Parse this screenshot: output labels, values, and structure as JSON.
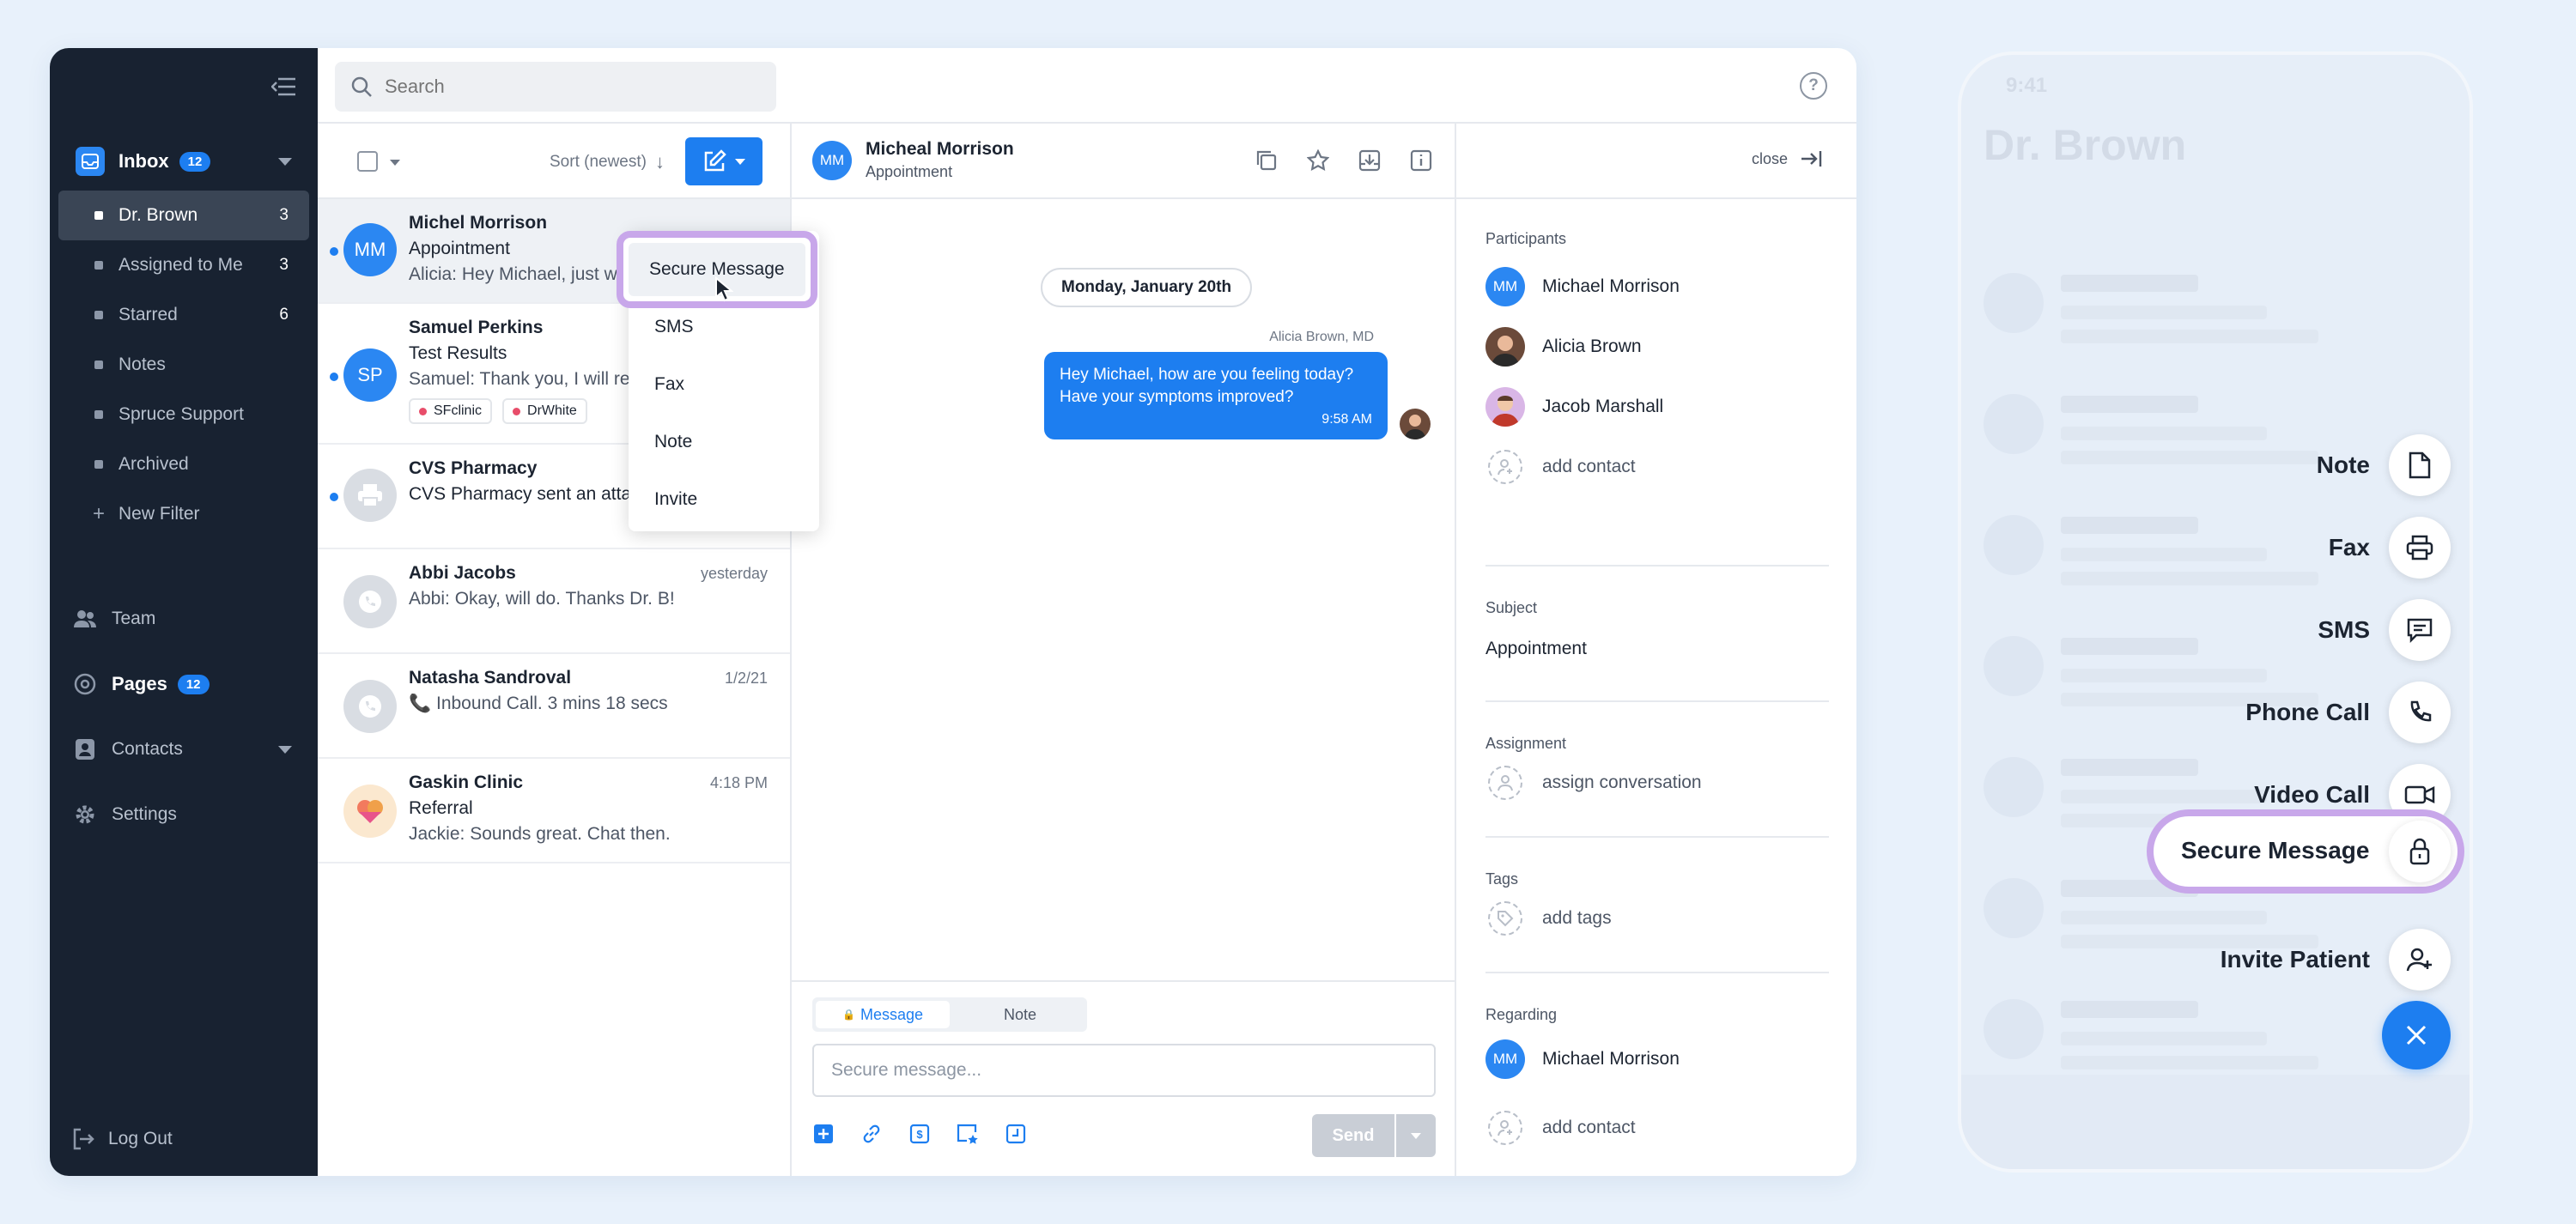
{
  "sidebar": {
    "inbox_label": "Inbox",
    "inbox_count": "12",
    "sub_items": [
      {
        "label": "Dr. Brown",
        "count": "3"
      },
      {
        "label": "Assigned to Me",
        "count": "3"
      },
      {
        "label": "Starred",
        "count": "6"
      },
      {
        "label": "Notes",
        "count": ""
      },
      {
        "label": "Spruce Support",
        "count": ""
      },
      {
        "label": "Archived",
        "count": ""
      },
      {
        "label": "New Filter",
        "count": ""
      }
    ],
    "team_label": "Team",
    "pages_label": "Pages",
    "pages_count": "12",
    "contacts_label": "Contacts",
    "settings_label": "Settings",
    "logout_label": "Log Out"
  },
  "search": {
    "placeholder": "Search"
  },
  "list_toolbar": {
    "sort_label": "Sort (newest)"
  },
  "conversations": [
    {
      "name": "Michel Morrison",
      "initials": "MM",
      "subject": "Appointment",
      "preview": "Alicia: Hey Michael, just wanted to check",
      "time": ""
    },
    {
      "name": "Samuel Perkins",
      "initials": "SP",
      "subject": "Test Results",
      "preview": "Samuel: Thank you, I will review.",
      "time": "",
      "tags": [
        "SFclinic",
        "DrWhite"
      ]
    },
    {
      "name": "CVS Pharmacy",
      "initials": "",
      "subject": "",
      "preview": "CVS Pharmacy sent an attachment",
      "time": ""
    },
    {
      "name": "Abbi Jacobs",
      "initials": "",
      "subject": "",
      "preview": "Abbi: Okay, will do. Thanks Dr. B!",
      "time": "yesterday"
    },
    {
      "name": "Natasha Sandroval",
      "initials": "",
      "subject": "",
      "preview": "Inbound Call. 3 mins 18 secs",
      "time": "1/2/21"
    },
    {
      "name": "Gaskin Clinic",
      "initials": "",
      "subject": "Referral",
      "preview": "Jackie: Sounds great. Chat then.",
      "time": "4:18 PM"
    }
  ],
  "compose_menu": [
    "Secure Message",
    "SMS",
    "Fax",
    "Note",
    "Invite"
  ],
  "chat": {
    "contact_name": "Micheal Morrison",
    "contact_initials": "MM",
    "subject": "Appointment",
    "date_chip": "Monday, January 20th",
    "sender": "Alicia Brown, MD",
    "message_line1": "Hey Michael, how are you feeling today?",
    "message_line2": "Have your symptoms improved?",
    "message_time": "9:58 AM",
    "tab_message": "Message",
    "tab_note": "Note",
    "input_placeholder": "Secure message...",
    "send_label": "Send"
  },
  "details": {
    "close_label": "close",
    "participants_title": "Participants",
    "participants": [
      {
        "name": "Michael Morrison",
        "initials": "MM"
      },
      {
        "name": "Alicia Brown",
        "initials": ""
      },
      {
        "name": "Jacob Marshall",
        "initials": ""
      }
    ],
    "add_contact": "add contact",
    "subject_title": "Subject",
    "subject_value": "Appointment",
    "assignment_title": "Assignment",
    "assign_label": "assign conversation",
    "tags_title": "Tags",
    "add_tags": "add tags",
    "regarding_title": "Regarding",
    "regarding_name": "Michael Morrison",
    "regarding_initials": "MM",
    "regarding_add": "add contact"
  },
  "phone": {
    "status_time": "9:41",
    "title": "Dr. Brown",
    "actions": [
      "Note",
      "Fax",
      "SMS",
      "Phone Call",
      "Video Call",
      "Secure Message",
      "Invite Patient"
    ]
  },
  "colors": {
    "accent": "#1d7ef0",
    "highlight": "#c8a7ea",
    "sidebar": "#182231"
  }
}
